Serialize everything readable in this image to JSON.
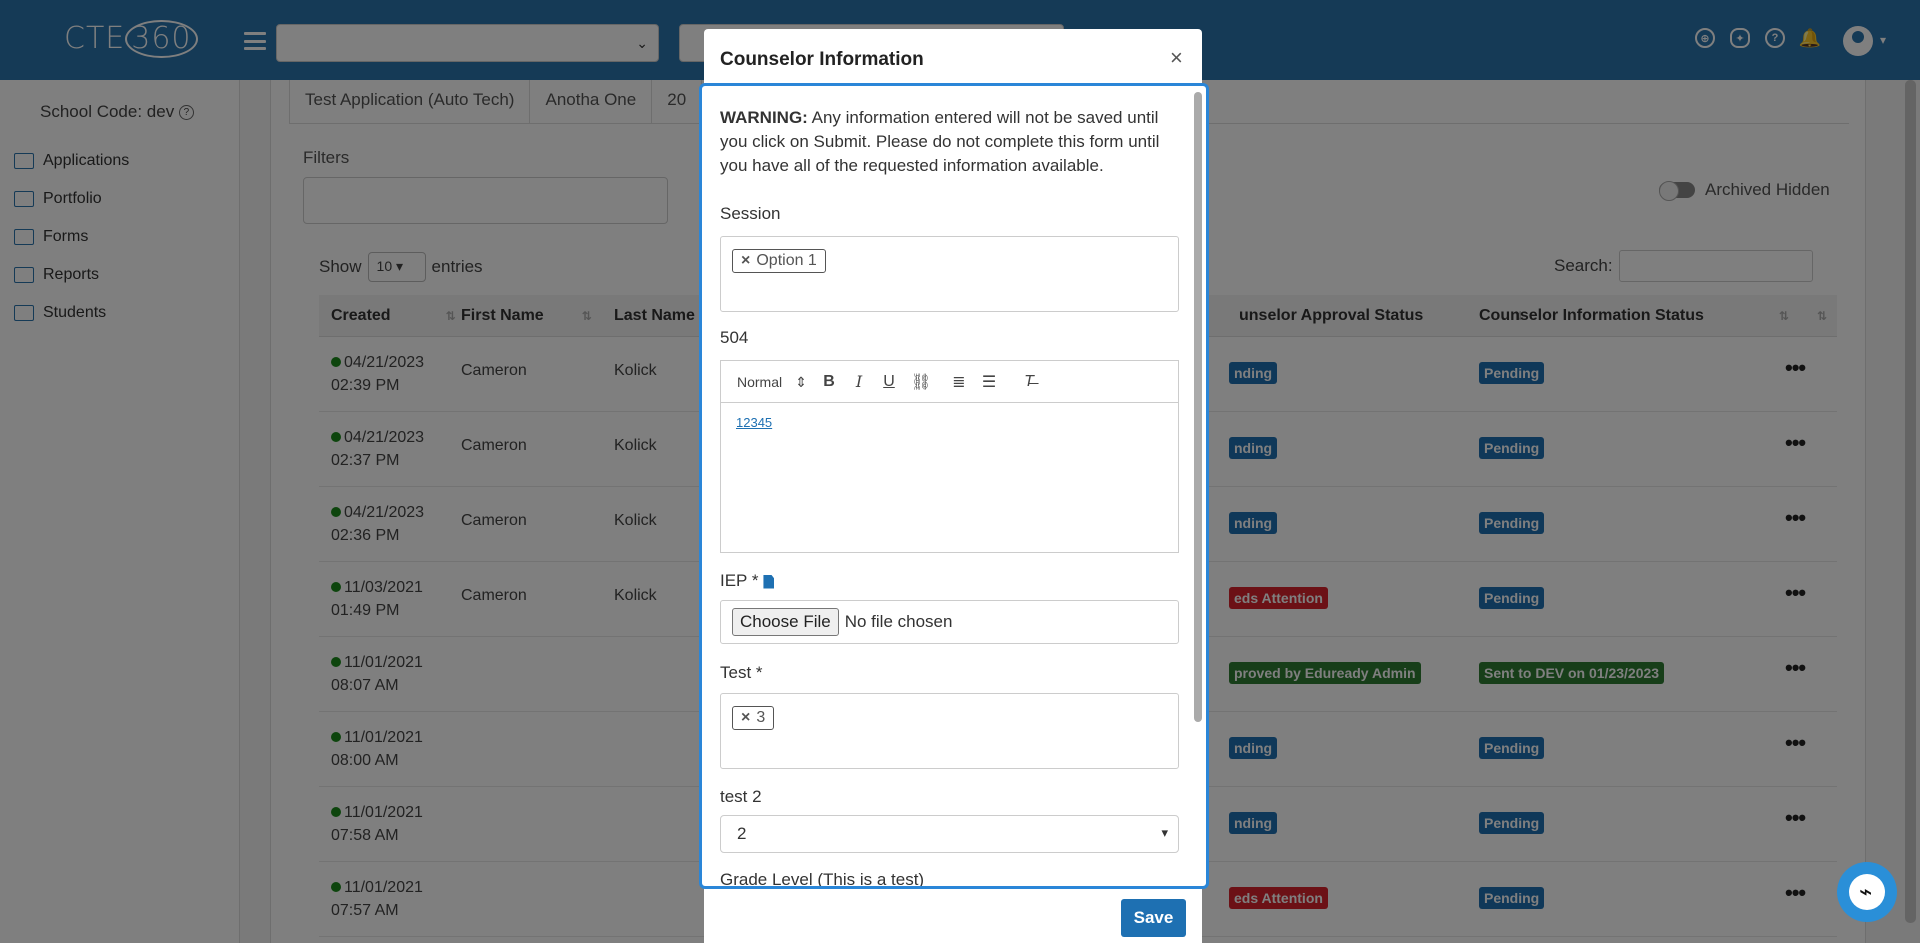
{
  "app": {
    "logo": "CTE",
    "logo_circle": "360"
  },
  "topbar": {
    "select_value": "",
    "search_placeholder": ""
  },
  "sidebar": {
    "school_code": "School Code: dev",
    "items": [
      {
        "label": "Applications",
        "icon": "search-doc-icon"
      },
      {
        "label": "Portfolio",
        "icon": "briefcase-icon"
      },
      {
        "label": "Forms",
        "icon": "form-icon"
      },
      {
        "label": "Reports",
        "icon": "print-icon"
      },
      {
        "label": "Students",
        "icon": "graduation-cap-icon"
      }
    ]
  },
  "main": {
    "tabs": [
      "Test Application (Auto Tech)",
      "Anotha One",
      "20"
    ],
    "filters_label": "Filters",
    "show_label": "Show",
    "entries_value": "10",
    "entries_label": "entries",
    "archived_label": "Archived Hidden",
    "search_label": "Search:",
    "columns": [
      "Created",
      "First Name",
      "Last Name",
      "unselor Approval Status",
      "Counselor Information Status"
    ],
    "rows": [
      {
        "date": "04/21/2023",
        "time": "02:39 PM",
        "first": "Cameron",
        "last": "Kolick",
        "approval": "nding",
        "approval_color": "#1e70b2",
        "info": "Pending",
        "info_color": "#1e70b2"
      },
      {
        "date": "04/21/2023",
        "time": "02:37 PM",
        "first": "Cameron",
        "last": "Kolick",
        "approval": "nding",
        "approval_color": "#1e70b2",
        "info": "Pending",
        "info_color": "#1e70b2"
      },
      {
        "date": "04/21/2023",
        "time": "02:36 PM",
        "first": "Cameron",
        "last": "Kolick",
        "approval": "nding",
        "approval_color": "#1e70b2",
        "info": "Pending",
        "info_color": "#1e70b2"
      },
      {
        "date": "11/03/2021",
        "time": "01:49 PM",
        "first": "Cameron",
        "last": "Kolick",
        "approval": "eds Attention",
        "approval_color": "#d9232d",
        "info": "Pending",
        "info_color": "#1e70b2"
      },
      {
        "date": "11/01/2021",
        "time": "08:07 AM",
        "first": "",
        "last": "",
        "approval": "proved by Eduready Admin",
        "approval_color": "#2e7d32",
        "info": "Sent to DEV on 01/23/2023",
        "info_color": "#2e7d32"
      },
      {
        "date": "11/01/2021",
        "time": "08:00 AM",
        "first": "",
        "last": "",
        "approval": "nding",
        "approval_color": "#1e70b2",
        "info": "Pending",
        "info_color": "#1e70b2"
      },
      {
        "date": "11/01/2021",
        "time": "07:58 AM",
        "first": "",
        "last": "",
        "approval": "nding",
        "approval_color": "#1e70b2",
        "info": "Pending",
        "info_color": "#1e70b2"
      },
      {
        "date": "11/01/2021",
        "time": "07:57 AM",
        "first": "",
        "last": "",
        "approval": "eds Attention",
        "approval_color": "#d9232d",
        "info": "Pending",
        "info_color": "#1e70b2"
      }
    ]
  },
  "modal": {
    "title": "Counselor Information",
    "close": "×",
    "warning_bold": "WARNING:",
    "warning_text": " Any information entered will not be saved until you click on Submit. Please do not complete this form until you have all of the requested information available.",
    "session_label": "Session",
    "session_chip": "Option 1",
    "f504_label": "504",
    "editor_format": "Normal",
    "editor_content": "12345",
    "iep_label": "IEP *",
    "file_button": "Choose File",
    "file_status": "No file chosen",
    "test_label": "Test *",
    "test_chip": "3",
    "test2_label": "test 2",
    "test2_value": "2",
    "grade_label": "Grade Level (This is a test)",
    "save": "Save"
  }
}
